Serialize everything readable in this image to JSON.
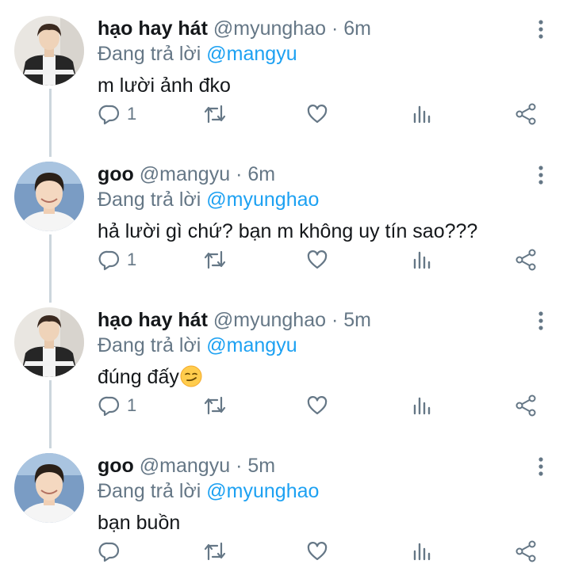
{
  "reply_prefix": "Đang trả lời",
  "tweets": [
    {
      "name": "hạo hay hát",
      "handle": "@myunghao",
      "separator": "·",
      "time": "6m",
      "reply_to": "@mangyu",
      "text": "m lười ảnh đko",
      "reply_count": "1",
      "avatar": "avatar-hao"
    },
    {
      "name": "goo",
      "handle": "@mangyu",
      "separator": "·",
      "time": "6m",
      "reply_to": "@myunghao",
      "text": "hả lười gì chứ? bạn m không uy tín sao???",
      "reply_count": "1",
      "avatar": "avatar-goo"
    },
    {
      "name": "hạo hay hát",
      "handle": "@myunghao",
      "separator": "·",
      "time": "5m",
      "reply_to": "@mangyu",
      "text": "đúng đấy",
      "emoji": "smirking-face-emoji",
      "reply_count": "1",
      "avatar": "avatar-hao"
    },
    {
      "name": "goo",
      "handle": "@mangyu",
      "separator": "·",
      "time": "5m",
      "reply_to": "@myunghao",
      "text": "bạn buồn",
      "reply_count": "",
      "avatar": "avatar-goo"
    }
  ],
  "icons": {
    "reply": "reply-icon",
    "retweet": "retweet-icon",
    "like": "like-icon",
    "analytics": "analytics-icon",
    "share": "share-icon",
    "more": "more-vertical-icon"
  },
  "colors": {
    "name": "#14171a",
    "secondary": "#657786",
    "mention": "#1da1f2",
    "thread_line": "#ccd6dd"
  }
}
